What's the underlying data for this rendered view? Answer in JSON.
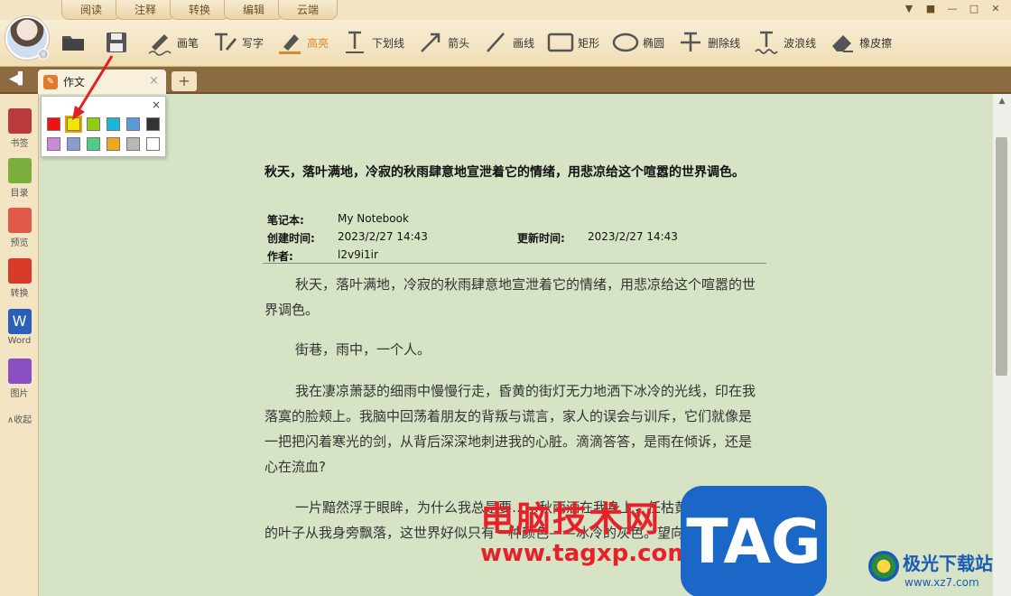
{
  "top_tabs": [
    "阅读",
    "注释",
    "转换",
    "编辑",
    "云端"
  ],
  "toolbar": {
    "tools": [
      {
        "label": "画笔",
        "icon": "pen-icon"
      },
      {
        "label": "写字",
        "icon": "write-icon"
      },
      {
        "label": "高亮",
        "icon": "highlight-icon"
      },
      {
        "label": "下划线",
        "icon": "underline-icon"
      },
      {
        "label": "箭头",
        "icon": "arrow-icon"
      },
      {
        "label": "画线",
        "icon": "line-icon"
      },
      {
        "label": "矩形",
        "icon": "rectangle-icon"
      },
      {
        "label": "椭圆",
        "icon": "ellipse-icon"
      },
      {
        "label": "删除线",
        "icon": "strikethrough-icon"
      },
      {
        "label": "波浪线",
        "icon": "wavy-line-icon"
      },
      {
        "label": "橡皮擦",
        "icon": "eraser-icon"
      }
    ],
    "active_tool": "高亮",
    "highlight_color": "#d8882a"
  },
  "tabbar": {
    "doc_tab_title": "作文",
    "add_tab": "+",
    "close": "×"
  },
  "sidebar": {
    "items": [
      {
        "label": "书签",
        "icon": "bookmark-icon",
        "color": "#b83a3a"
      },
      {
        "label": "目录",
        "icon": "toc-icon",
        "color": "#7cae3c"
      },
      {
        "label": "预览",
        "icon": "preview-icon",
        "color": "#e05a4a"
      },
      {
        "label": "转换",
        "icon": "convert-icon",
        "color": "#d93b2b"
      },
      {
        "label": "Word",
        "icon": "word-icon",
        "color": "#2b5fb8"
      },
      {
        "label": "图片",
        "icon": "image-icon",
        "color": "#8a4fc0"
      }
    ],
    "collapse_label": "∧收起"
  },
  "color_popup": {
    "close": "×",
    "colors": [
      "#ee1111",
      "#f2e600",
      "#8fcc14",
      "#1fb5d6",
      "#5a9ad6",
      "#333333",
      "#cc8ad6",
      "#8a9ccc",
      "#4ecc88",
      "#f0a818",
      "#b8b8b8",
      "#ffffff"
    ],
    "selected": "#f2e600"
  },
  "document": {
    "title": "秋天，落叶满地，冷寂的秋雨肆意地宣泄着它的情绪，用悲凉给这个喧嚣的世界调色。",
    "meta": {
      "notebook_key": "笔记本:",
      "notebook_val": "My Notebook",
      "created_key": "创建时间:",
      "created_val": "2023/2/27 14:43",
      "updated_key": "更新时间:",
      "updated_val": "2023/2/27 14:43",
      "author_key": "作者:",
      "author_val": "l2v9i1ir"
    },
    "paragraphs": [
      "秋天，落叶满地，冷寂的秋雨肆意地宣泄着它的情绪，用悲凉给这个喧嚣的世界调色。",
      "街巷，雨中，一个人。",
      "我在凄凉萧瑟的细雨中慢慢行走，昏黄的街灯无力地洒下冰冷的光线，印在我落寞的脸颊上。我脑中回荡着朋友的背叛与谎言，家人的误会与训斥，它们就像是一把把闪着寒光的剑，从背后深深地刺进我的心脏。滴滴答答，是雨在倾诉，还是心在流血?",
      "一片黯然浮于眼眸，为什么我总是要……秋雨洒在我身上，任枯黄而又不知名的叶子从我身旁飘落，这世界好似只有一种颜色——冰冷的灰色。望向灰"
    ]
  },
  "watermark": {
    "main": "电脑技术网",
    "url": "www.tagxp.com",
    "tag": "TAG"
  },
  "logo2": {
    "name": "极光下载站",
    "url": "www.xz7.com"
  }
}
